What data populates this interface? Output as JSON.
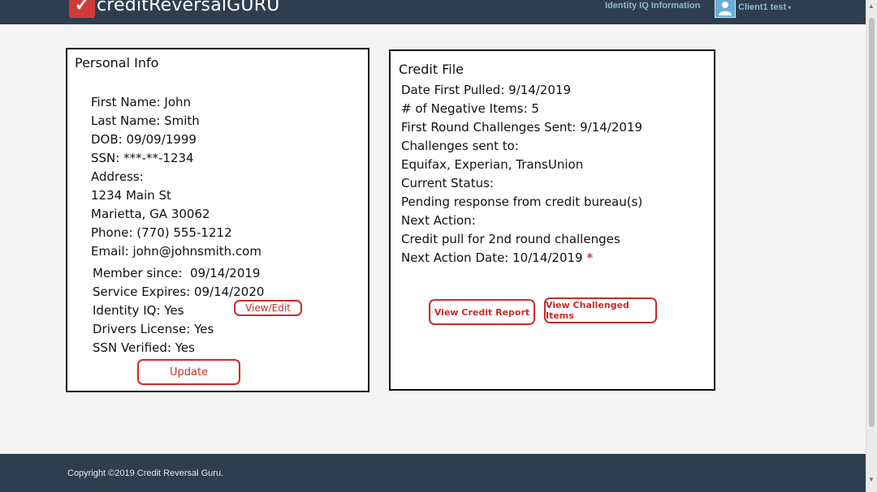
{
  "header": {
    "logo_mark": "✓",
    "logo_text": "creditReversalGURU",
    "identity_iq_link": "Identity IQ Information",
    "user_name": "Client1 test",
    "caret": "▾",
    "avatar_icon": "user-avatar-icon"
  },
  "personal": {
    "title": "Personal Info",
    "first_name": "First Name: John",
    "last_name": "Last Name: Smith",
    "dob": "DOB: 09/09/1999",
    "ssn": "SSN: ***-**-1234",
    "address_label": "Address:",
    "address_line1": "1234 Main St",
    "address_line2": "Marietta, GA 30062",
    "phone": "Phone: (770) 555-1212",
    "email": "Email: john@johnsmith.com",
    "member_since": "Member since:  09/14/2019",
    "service_expires": "Service Expires: 09/14/2020",
    "identity_iq": "Identity IQ: Yes",
    "drivers_license": "Drivers License: Yes",
    "ssn_verified": "SSN Verified: Yes",
    "view_edit_label": "View/Edit",
    "update_label": "Update"
  },
  "credit": {
    "title": "Credit File",
    "date_first_pulled": "Date First Pulled: 9/14/2019",
    "negative_items": "# of Negative Items: 5",
    "first_round_sent": "First Round Challenges Sent: 9/14/2019",
    "challenges_label": "Challenges sent to:",
    "challenges_value": "Equifax, Experian, TransUnion",
    "status_label": "Current Status:",
    "status_value": "Pending response from credit bureau(s)",
    "next_action_label": "Next Action:",
    "next_action_value": "Credit pull for 2nd round challenges",
    "next_action_date": "Next Action Date: 10/14/2019",
    "required_mark": "*",
    "view_report_label": "View Credit Report",
    "view_challenged_label": "View Challenged Items"
  },
  "footer": {
    "copyright": "Copyright ©2019 Credit Reversal Guru."
  },
  "colors": {
    "nav_bg": "#2e3e4e",
    "accent_red": "#c72c2c",
    "link_blue": "#8fb8d4"
  }
}
